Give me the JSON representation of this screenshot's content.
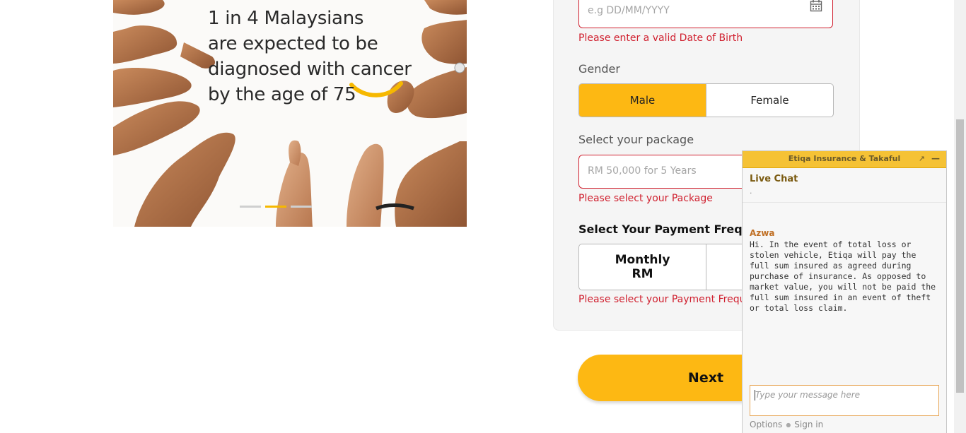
{
  "banner": {
    "lines": [
      "1 in 4 Malaysians",
      "are expected to be",
      "diagnosed with cancer",
      "by the age of 75"
    ],
    "slides_total": 3,
    "active_slide": 2
  },
  "form": {
    "dob_placeholder": "e.g DD/MM/YYYY",
    "dob_error": "Please enter a valid Date of Birth",
    "gender_label": "Gender",
    "gender_options": [
      "Male",
      "Female"
    ],
    "gender_selected": "Male",
    "package_label": "Select your package",
    "package_placeholder": "RM 50,000 for 5 Years",
    "package_error": "Please select your Package",
    "freq_label": "Select Your Payment Frequenc",
    "freq_option_1_line1": "Monthly",
    "freq_option_1_line2": "RM",
    "freq_error": "Please select your Payment Frequenc",
    "next_label": "Next"
  },
  "chat": {
    "title": "Etiqa Insurance & Takaful",
    "section_title": "Live Chat",
    "status_dot": ".",
    "agent_name": "Azwa",
    "message": "Hi. In the event of total loss or stolen vehicle, Etiqa will pay the full sum insured as agreed during purchase of insurance. As opposed to market value, you will not be paid the full sum insured in an event of theft or total loss claim.",
    "input_placeholder": "Type your message here",
    "footer_options": "Options",
    "footer_signin": "Sign in"
  },
  "colors": {
    "accent": "#fdb813",
    "error": "#d0202f",
    "chat_header": "#f5c235"
  }
}
